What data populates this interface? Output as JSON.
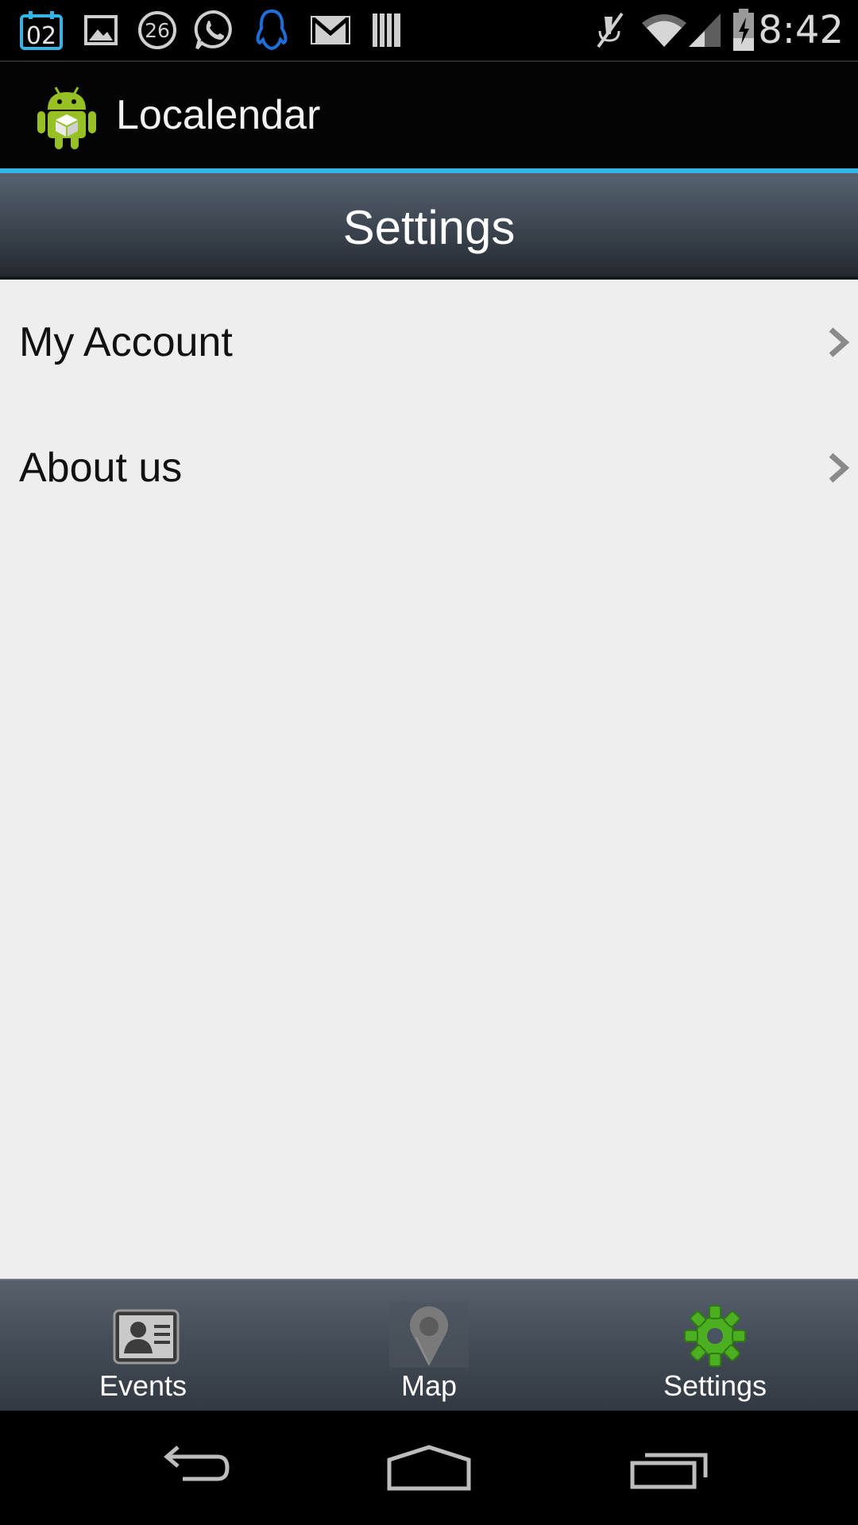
{
  "status_bar": {
    "calendar_day": "02",
    "badge_number": "26",
    "time": "8:42",
    "icons": [
      "calendar-icon",
      "gallery-icon",
      "badge-26-icon",
      "whatsapp-icon",
      "qq-icon",
      "gmail-icon",
      "barcode-icon",
      "mute-icon",
      "wifi-icon",
      "signal-icon",
      "battery-icon"
    ]
  },
  "action_bar": {
    "app_name": "Localendar",
    "logo_icon": "android-icon"
  },
  "header": {
    "title": "Settings"
  },
  "settings": {
    "items": [
      {
        "label": "My Account",
        "icon": "chevron-right-icon"
      },
      {
        "label": "About us",
        "icon": "chevron-right-icon"
      }
    ]
  },
  "tabs": [
    {
      "label": "Events",
      "icon": "contact-card-icon",
      "selected": false
    },
    {
      "label": "Map",
      "icon": "map-pin-icon",
      "selected": false
    },
    {
      "label": "Settings",
      "icon": "gear-icon",
      "selected": true
    }
  ],
  "nav_bar": {
    "buttons": [
      "back-icon",
      "home-icon",
      "recent-apps-icon"
    ]
  },
  "colors": {
    "accent": "#33b5e5",
    "list_background": "#eeeeee",
    "settings_gear": "#4caf22"
  }
}
